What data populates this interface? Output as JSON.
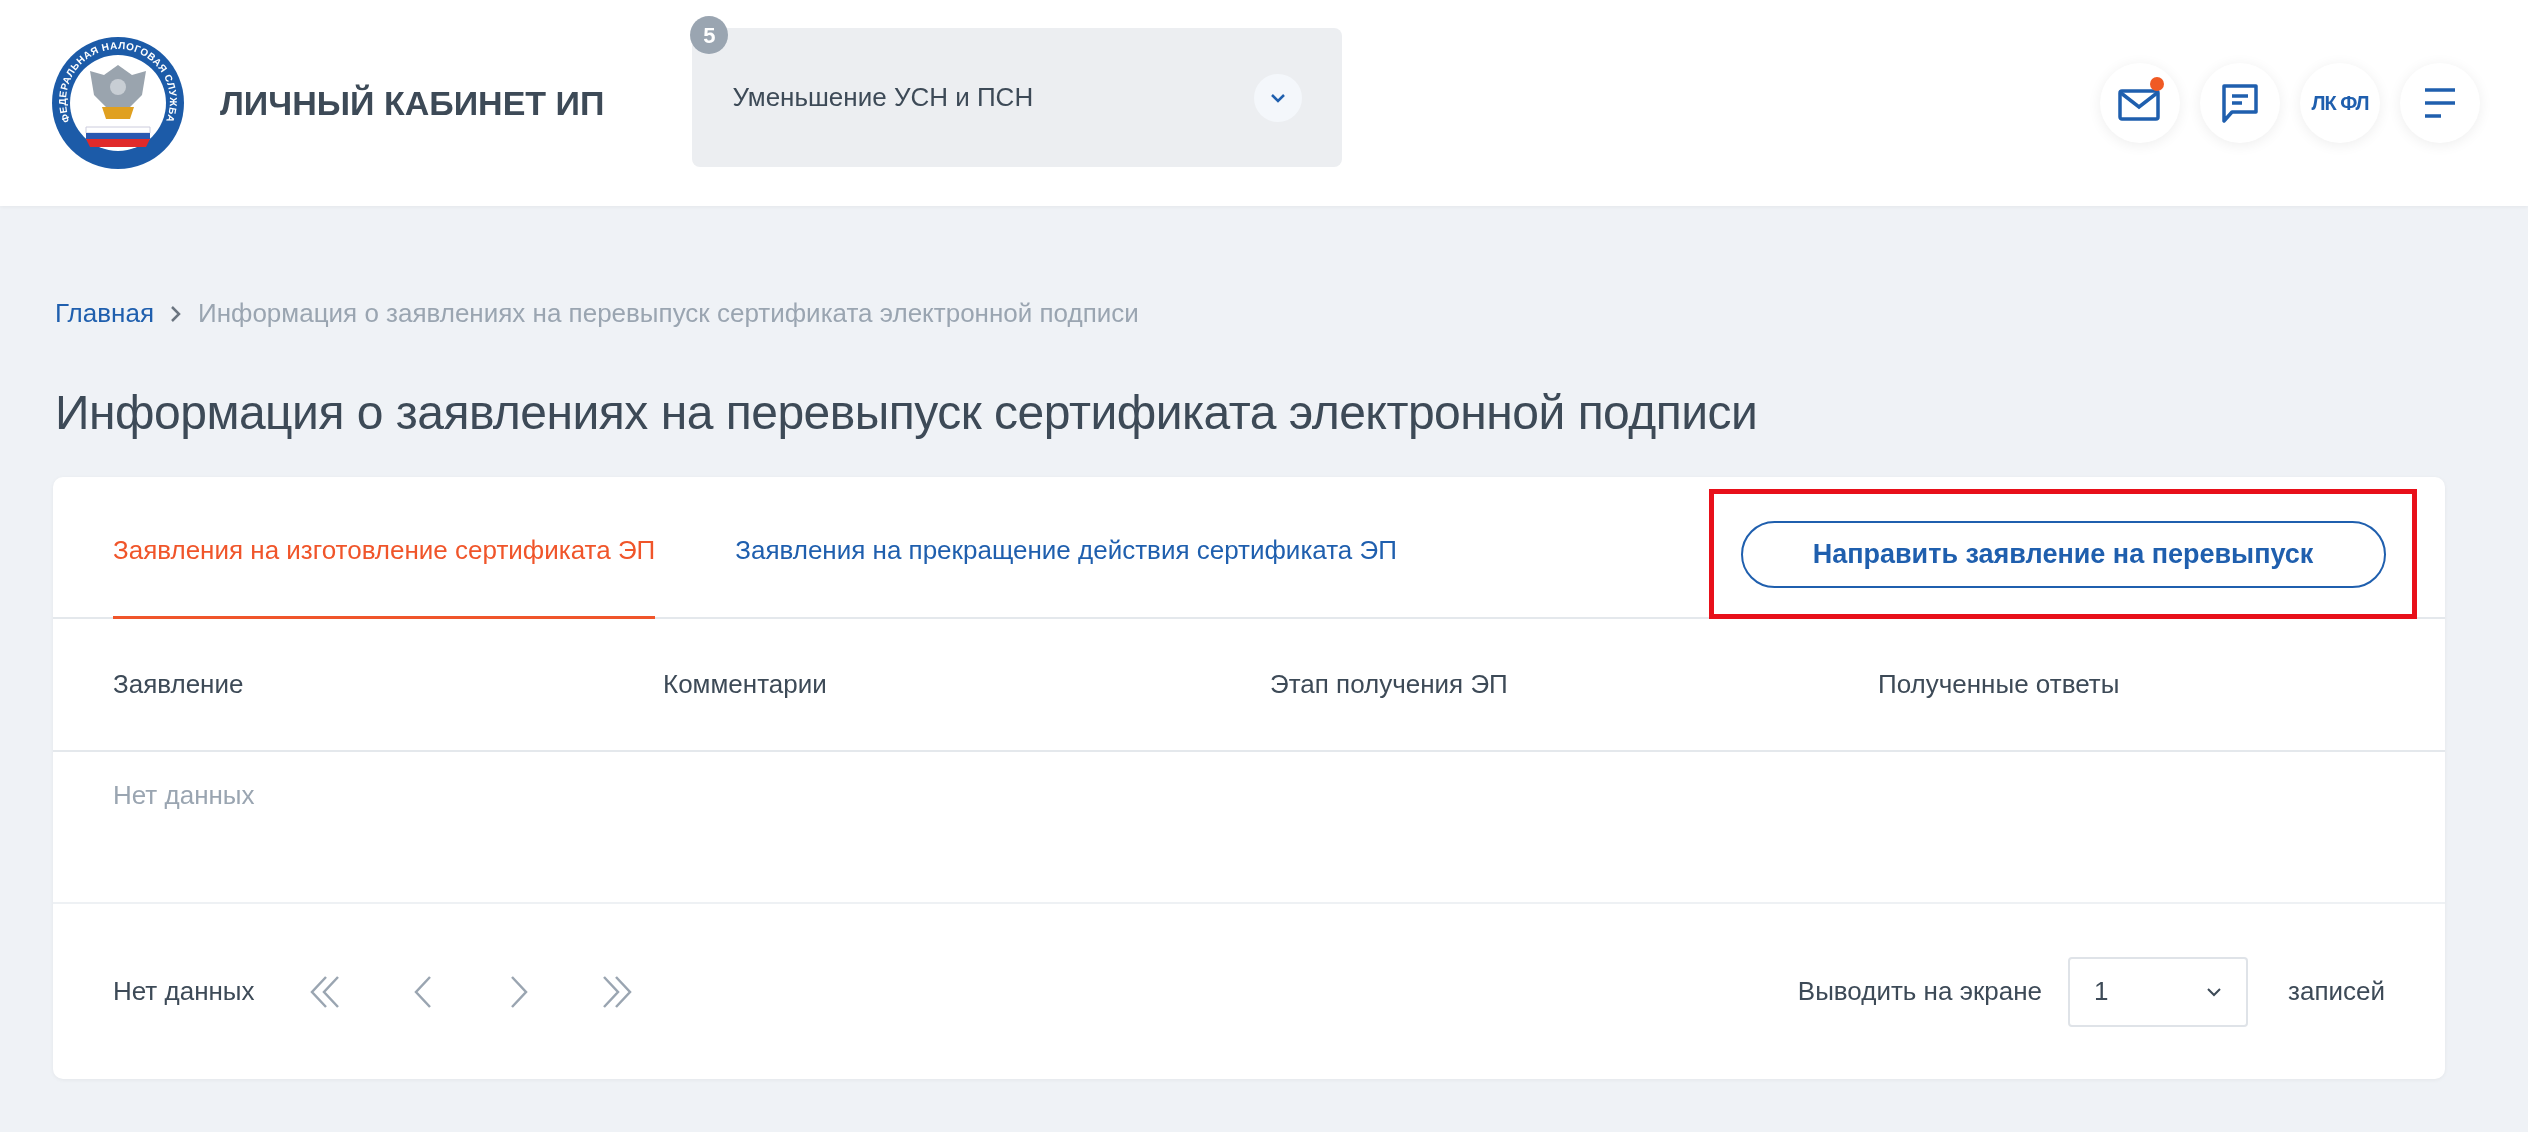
{
  "header": {
    "logo_text": "ФЕДЕРАЛЬНАЯ НАЛОГОВАЯ СЛУЖБА",
    "title": "ЛИЧНЫЙ КАБИНЕТ ИП",
    "selector": {
      "badge": "5",
      "value": "Уменьшение УСН и ПСН"
    },
    "actions": [
      {
        "kind": "mail",
        "unread": true
      },
      {
        "kind": "chat"
      },
      {
        "kind": "text",
        "label": "ЛК ФЛ"
      },
      {
        "kind": "menu"
      }
    ]
  },
  "breadcrumbs": [
    {
      "kind": "link",
      "label": "Главная"
    },
    {
      "kind": "current",
      "label": "Информация о заявлениях на перевыпуск сертификата электронной подписи"
    }
  ],
  "page_title": "Информация о заявлениях на перевыпуск сертификата электронной подписи",
  "tabs": [
    {
      "label": "Заявления на изготовление сертификата ЭП",
      "selected": true
    },
    {
      "label": "Заявления на прекращение действия сертификата ЭП",
      "selected": false
    }
  ],
  "action_button": "Направить заявление на перевыпуск",
  "table": {
    "columns": [
      "Заявление",
      "Комментарии",
      "Этап получения ЭП",
      "Полученные ответы"
    ],
    "empty_text": "Нет данных"
  },
  "footer": {
    "status": "Нет данных",
    "per_page_label": "Выводить на экране",
    "per_page": "1",
    "per_page_suffix": "записей"
  }
}
